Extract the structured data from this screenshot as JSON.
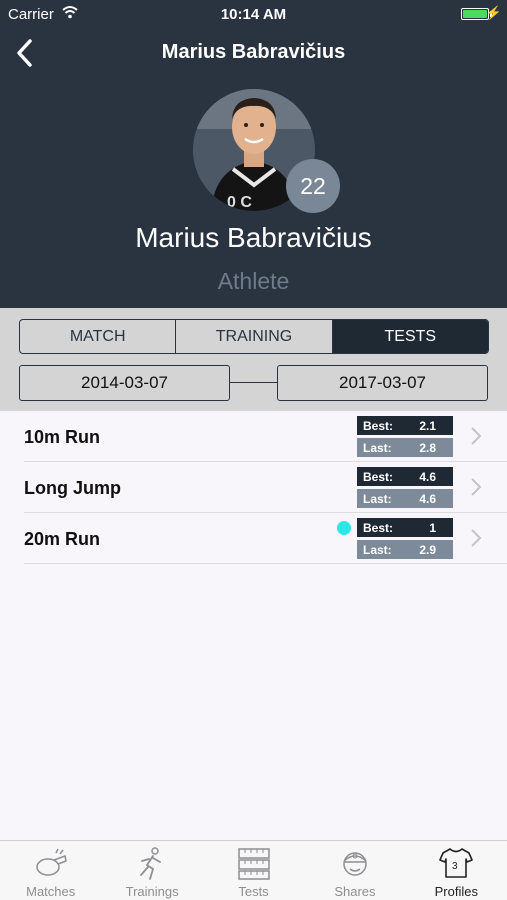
{
  "status_bar": {
    "carrier": "Carrier",
    "time": "10:14 AM"
  },
  "nav": {
    "title": "Marius Babravičius"
  },
  "profile": {
    "name": "Marius Babravičius",
    "role": "Athlete",
    "number": "22"
  },
  "segments": [
    {
      "label": "MATCH",
      "active": false
    },
    {
      "label": "TRAINING",
      "active": false
    },
    {
      "label": "TESTS",
      "active": true
    }
  ],
  "date_range": {
    "from": "2014-03-07",
    "to": "2017-03-07"
  },
  "tests": [
    {
      "name": "10m Run",
      "best_label": "Best:",
      "best": "2.1",
      "last_label": "Last:",
      "last": "2.8",
      "new_indicator": false
    },
    {
      "name": "Long Jump",
      "best_label": "Best:",
      "best": "4.6",
      "last_label": "Last:",
      "last": "4.6",
      "new_indicator": false
    },
    {
      "name": "20m Run",
      "best_label": "Best:",
      "best": "1",
      "last_label": "Last:",
      "last": "2.9",
      "new_indicator": true
    }
  ],
  "tabbar": [
    {
      "label": "Matches",
      "icon": "whistle-icon",
      "active": false
    },
    {
      "label": "Trainings",
      "icon": "running-person-icon",
      "active": false
    },
    {
      "label": "Tests",
      "icon": "measuring-tape-icon",
      "active": false
    },
    {
      "label": "Shares",
      "icon": "coach-cap-icon",
      "active": false
    },
    {
      "label": "Profiles",
      "icon": "jersey-icon",
      "active": true
    }
  ],
  "colors": {
    "header": "#2a3441",
    "accent_dark": "#1f2934",
    "stat_last": "#7d8a99",
    "new_dot": "#2ee6e6",
    "battery": "#4cd964"
  }
}
